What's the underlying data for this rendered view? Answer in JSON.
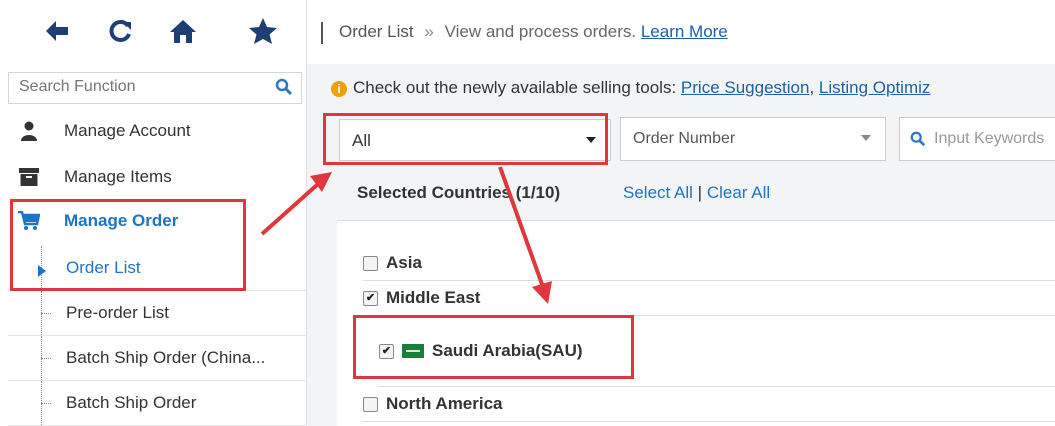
{
  "toolbar": {
    "icons": [
      "back-arrow-icon",
      "refresh-icon",
      "home-icon",
      "star-icon"
    ]
  },
  "search": {
    "placeholder": "Search Function"
  },
  "nav": {
    "manage_account": "Manage Account",
    "manage_items": "Manage Items",
    "manage_order": "Manage Order",
    "order_list": "Order List",
    "preorder_list": "Pre-order List",
    "batch_ship_china": "Batch Ship Order (China...",
    "batch_ship": "Batch Ship Order"
  },
  "header": {
    "title": "Order List",
    "separator": "»",
    "desc": "View and process orders.",
    "learn_more": "Learn More"
  },
  "notice": {
    "text": "Check out the newly available selling tools:",
    "link1": "Price Suggestion",
    "comma": ",",
    "link2": "Listing Optimiz"
  },
  "filters": {
    "country_select": "All",
    "order_type": "Order Number",
    "keyword_placeholder": "Input Keywords"
  },
  "countries": {
    "title": "Selected Countries (1/10)",
    "select_all": "Select All",
    "pipe": "|",
    "clear_all": "Clear All",
    "rows": [
      {
        "label": "Asia",
        "checked": false
      },
      {
        "label": "Middle East",
        "checked": true
      },
      {
        "label": "Saudi Arabia(SAU)",
        "checked": true
      },
      {
        "label": "North America",
        "checked": false
      }
    ]
  },
  "colors": {
    "highlight": "#e0363e",
    "link": "#1f5fa8",
    "accent_blue": "#1f73c4",
    "icon_navy": "#1d3f73"
  }
}
